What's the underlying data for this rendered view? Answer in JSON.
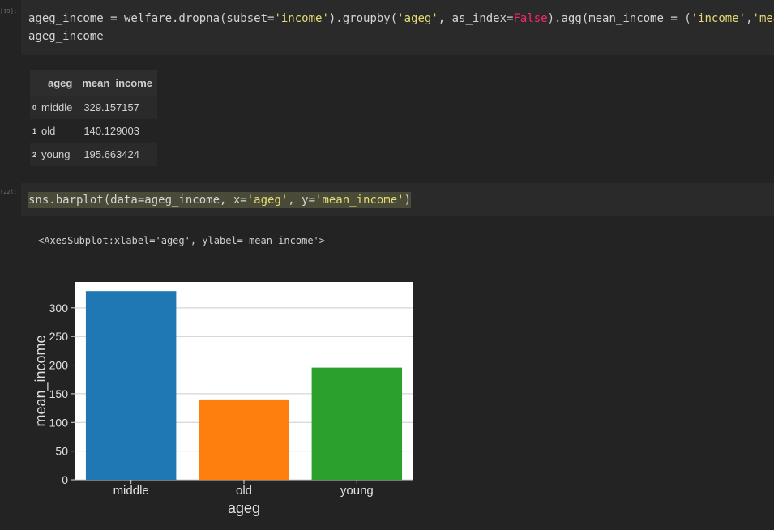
{
  "cells": {
    "cell19": {
      "label": "[19]:",
      "line1_a": "ageg_income = welfare.dropna(subset=",
      "line1_s1": "'income'",
      "line1_b": ").groupby(",
      "line1_s2": "'ageg'",
      "line1_c": ", as_index=",
      "line1_kw": "False",
      "line1_d": ").agg(mean_income = (",
      "line1_s3": "'income'",
      "line1_e": ",",
      "line1_s4": "'mean'",
      "line1_f": "))",
      "line2": "ageg_income"
    },
    "cell22": {
      "label": "[22]:",
      "code_a": "sns.barplot(data=ageg_income, x=",
      "code_s1": "'ageg'",
      "code_b": ", y=",
      "code_s2": "'mean_income'",
      "code_c": ")",
      "repr": "<AxesSubplot:xlabel='ageg', ylabel='mean_income'>"
    }
  },
  "dataframe": {
    "columns": [
      "ageg",
      "mean_income"
    ],
    "rows": [
      {
        "index": "0",
        "ageg": "middle",
        "mean_income": "329.157157"
      },
      {
        "index": "1",
        "ageg": "old",
        "mean_income": "140.129003"
      },
      {
        "index": "2",
        "ageg": "young",
        "mean_income": "195.663424"
      }
    ]
  },
  "colors": {
    "background": "#232323",
    "cell_background": "#2a2a2a",
    "string": "#e6db74",
    "keyword": "#f92672"
  },
  "chart_data": {
    "type": "bar",
    "categories": [
      "middle",
      "old",
      "young"
    ],
    "values": [
      329.157157,
      140.129003,
      195.663424
    ],
    "colors": [
      "#1f77b4",
      "#ff7f0e",
      "#2ca02c"
    ],
    "xlabel": "ageg",
    "ylabel": "mean_income",
    "ylim": [
      0,
      345
    ],
    "yticks": [
      0,
      50,
      100,
      150,
      200,
      250,
      300
    ],
    "grid": true
  }
}
